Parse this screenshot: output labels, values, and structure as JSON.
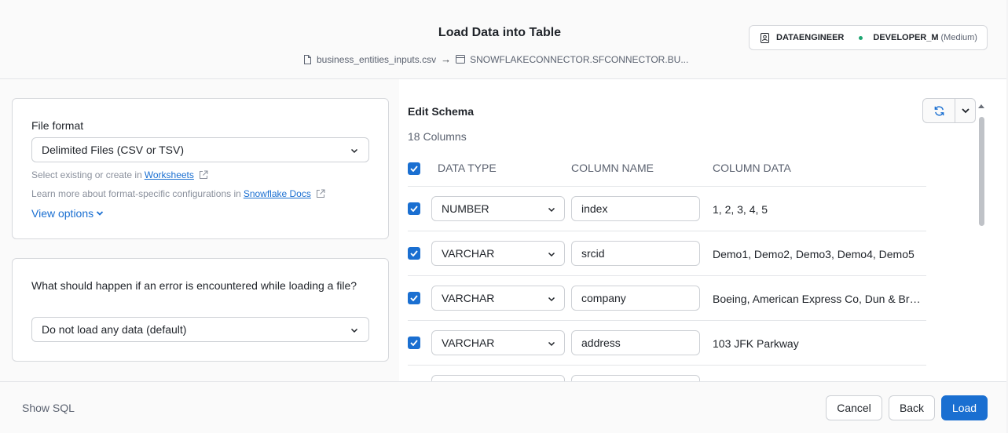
{
  "header": {
    "title": "Load Data into Table",
    "source_file": "business_entities_inputs.csv",
    "arrow": "→",
    "target": "SNOWFLAKECONNECTOR.SFCONNECTOR.BU...",
    "role": "DATAENGINEER",
    "warehouse": "DEVELOPER_M",
    "warehouse_size": "(Medium)"
  },
  "file_format": {
    "label": "File format",
    "value": "Delimited Files (CSV or TSV)",
    "hint1_prefix": "Select existing or create in",
    "hint1_link": "Worksheets",
    "hint2_prefix": "Learn more about format-specific configurations in",
    "hint2_link": "Snowflake Docs",
    "view_options": "View options"
  },
  "on_error": {
    "label": "What should happen if an error is encountered while loading a file?",
    "value": "Do not load any data (default)"
  },
  "schema": {
    "title": "Edit Schema",
    "count": "18 Columns",
    "headers": {
      "data_type": "DATA TYPE",
      "column_name": "COLUMN NAME",
      "column_data": "COLUMN DATA"
    },
    "rows": [
      {
        "type": "NUMBER",
        "name": "index",
        "data": "1, 2, 3, 4, 5"
      },
      {
        "type": "VARCHAR",
        "name": "srcid",
        "data": "Demo1, Demo2, Demo3, Demo4, Demo5"
      },
      {
        "type": "VARCHAR",
        "name": "company",
        "data": "Boeing, American Express Co, Dun & Bradstreet, Microsoft, Apple"
      },
      {
        "type": "VARCHAR",
        "name": "address",
        "data": "103 JFK Parkway"
      }
    ]
  },
  "footer": {
    "show_sql": "Show SQL",
    "cancel": "Cancel",
    "back": "Back",
    "load": "Load"
  },
  "colors": {
    "accent": "#1a6fd1",
    "status_dot": "#1ea672"
  }
}
